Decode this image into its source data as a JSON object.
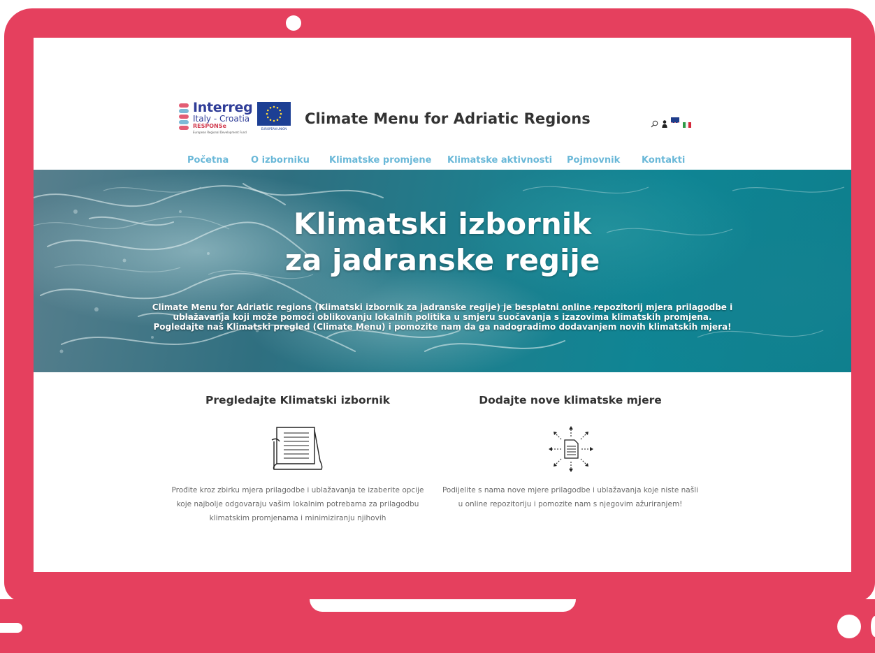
{
  "site": {
    "title": "Climate Menu for Adriatic Regions",
    "logo": {
      "title": "Interreg",
      "subtitle": "Italy - Croatia",
      "tag": "RESPONSe",
      "fund": "European Regional Development Fund",
      "eu_label": "EUROPEAN UNION"
    }
  },
  "header_tools": {
    "search_icon": "search-icon",
    "user_icon": "user-icon",
    "languages": [
      "en-flag",
      "it-flag"
    ]
  },
  "nav": {
    "items": [
      {
        "label": "Početna"
      },
      {
        "label": "O izborniku"
      },
      {
        "label": "Klimatske promjene"
      },
      {
        "label": "Klimatske aktivnosti"
      },
      {
        "label": "Pojmovnik"
      },
      {
        "label": "Kontakti"
      }
    ]
  },
  "hero": {
    "title_line1": "Klimatski izbornik",
    "title_line2": "za jadranske regije",
    "text": "Climate Menu for Adriatic regions (Klimatski izbornik za jadranske regije) je besplatni online repozitorij mjera prilagodbe i ublažavanja koji može pomoći oblikovanju lokalnih politika u smjeru suočavanja s izazovima klimatskih promjena. Pogledajte naš Klimatski pregled (Climate Menu) i pomozite nam da ga nadogradimo dodavanjem novih klimatskih mjera!"
  },
  "features": [
    {
      "title": "Pregledajte Klimatski izbornik",
      "icon": "book-icon",
      "text": "Prođite kroz zbirku mjera prilagodbe i ublažavanja te izaberite opcije koje najbolje odgovaraju vašim lokalnim potrebama za prilagodbu klimatskim promjenama i minimiziranju njihovih"
    },
    {
      "title": "Dodajte nove klimatske mjere",
      "icon": "share-document-icon",
      "text": "Podijelite s nama nove mjere prilagodbe i ublažavanja koje niste našli u online repozitoriju i pomozite nam s njegovim ažuriranjem!"
    }
  ],
  "colors": {
    "frame": "#e5405e",
    "nav_link": "#6ab8d8",
    "heading": "#333333",
    "body_text": "#6a6a6a"
  }
}
